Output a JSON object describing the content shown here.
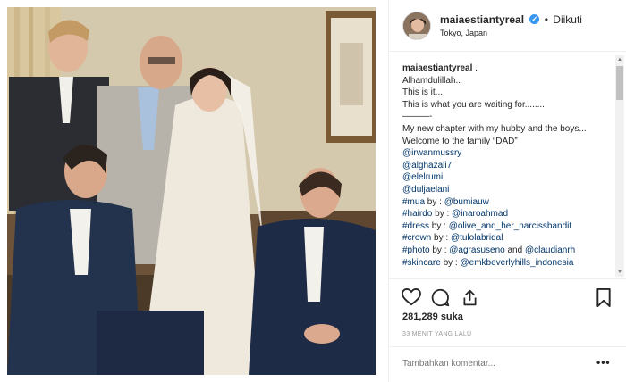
{
  "post": {
    "username": "maiaestiantyreal",
    "verified_badge": "✓",
    "follow_separator": "•",
    "follow_status": "Diikuti",
    "location": "Tokyo, Japan"
  },
  "caption": {
    "username": "maiaestiantyreal",
    "username_suffix": ".",
    "lines": [
      "Alhamdulillah..",
      "This is it...",
      "This is what you are waiting for........",
      "———-"
    ],
    "paragraph": "My new chapter with my hubby and the boys... Welcome to the family “DAD”",
    "mentions": [
      "@irwanmussry",
      "@alghazali7",
      "@elelrumi",
      "@duljaelani"
    ],
    "credits": [
      {
        "tag": "#mua",
        "sep": " by : ",
        "handle": "@bumiauw",
        "extra_sep": "",
        "extra": ""
      },
      {
        "tag": "#hairdo",
        "sep": " by : ",
        "handle": "@inaroahmad",
        "extra_sep": "",
        "extra": ""
      },
      {
        "tag": "#dress",
        "sep": " by : ",
        "handle": "@olive_and_her_narcissbandit",
        "extra_sep": "",
        "extra": ""
      },
      {
        "tag": "#crown",
        "sep": " by : ",
        "handle": "@tulolabridal",
        "extra_sep": "",
        "extra": ""
      },
      {
        "tag": "#photo",
        "sep": " by : ",
        "handle": "@agrasuseno",
        "extra_sep": " and ",
        "extra": "@claudianrh"
      },
      {
        "tag": "#skincare",
        "sep": " by : ",
        "handle": "@emkbeverlyhills_indonesia",
        "extra_sep": "",
        "extra": ""
      }
    ]
  },
  "icons": {
    "like": "heart-icon",
    "comment": "comment-icon",
    "share": "share-icon",
    "save": "bookmark-icon"
  },
  "likes": "281,289 suka",
  "time_ago": "33 MENIT YANG LALU",
  "comment": {
    "placeholder": "Tambahkan komentar...",
    "more_label": "•••"
  },
  "colors": {
    "link": "#003569",
    "verified": "#3897f0",
    "text": "#262626",
    "muted": "#999999"
  }
}
